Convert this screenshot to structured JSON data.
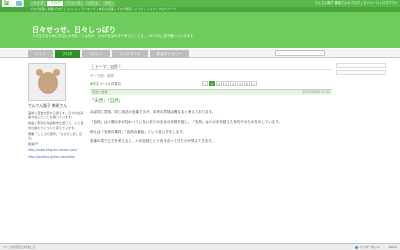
{
  "site": {
    "logo": "iz",
    "tabs": [
      "トップ",
      "ブログ",
      "ニュース",
      "コミュ",
      "ナビ"
    ],
    "active_tab": 1,
    "user_links": "でんでん猫子 美術さんのブログ | マイページ | ログアウト",
    "sublinks": "ブログ記事 | 新着ブログ | コメント | ランキング | 本日の記事 | ブログ検索 | イイぞ | ヘルプ | ブログパーツ"
  },
  "blog": {
    "title": "日々せっせ、日々しっぽり",
    "description": "人が生きるために本当に大切なことは何か、日々の生活の中で考えたことを、つれづれに書き綴っていきます。"
  },
  "nav": {
    "tabs": [
      "トップ",
      "ブログ",
      "コメント",
      "ブックマーク",
      "作品ギャラリー"
    ],
    "active": 1
  },
  "sidebar": {
    "name": "でんでん猫子 美術さん",
    "text1": "美術と音楽を愛する者です。日々の出来事や感じたことを綴っています。",
    "text2": "絵画と彫刻の作品制作を通じて、人と自然の関わりについて考えています。",
    "text3": "著書「こころの風景」「ひかりと影」ほか。",
    "url_label": "関連HP",
    "url": "http://www.blog.dcs-kawai.com/",
    "url2": "http://ameblo.jp/den-denneko/"
  },
  "main": {
    "header": "［ テーマ：自然 ］",
    "theme": "テーマ別：自然",
    "range": "6件中 1〜10 件表示",
    "pages": [
      "«",
      "1",
      "2",
      "3",
      "4",
      "5",
      "6",
      "»"
    ],
    "current_page": 1,
    "category": "天然と自然",
    "date": "2012/08/04 21:34",
    "entry_title": "「天然」「自然」",
    "paragraphs": [
      "ほぼ同じ意味、同じ用法の言葉ですが、本来の意味は異なると考えております。",
      "「自然」は人間の手が加わっていないありのままの状態を指し、「天然」は人の手を超えた存在そのものを示しています。",
      "例えば「天然の素材」「自然の景色」という言い方をします。",
      "言葉の成り立ちを考えると、人が自然とどう向き合ってきたかが見えてきます。"
    ]
  },
  "status": {
    "left": "ページが表示されました",
    "zone": "インターネット",
    "zoom": "100%"
  }
}
